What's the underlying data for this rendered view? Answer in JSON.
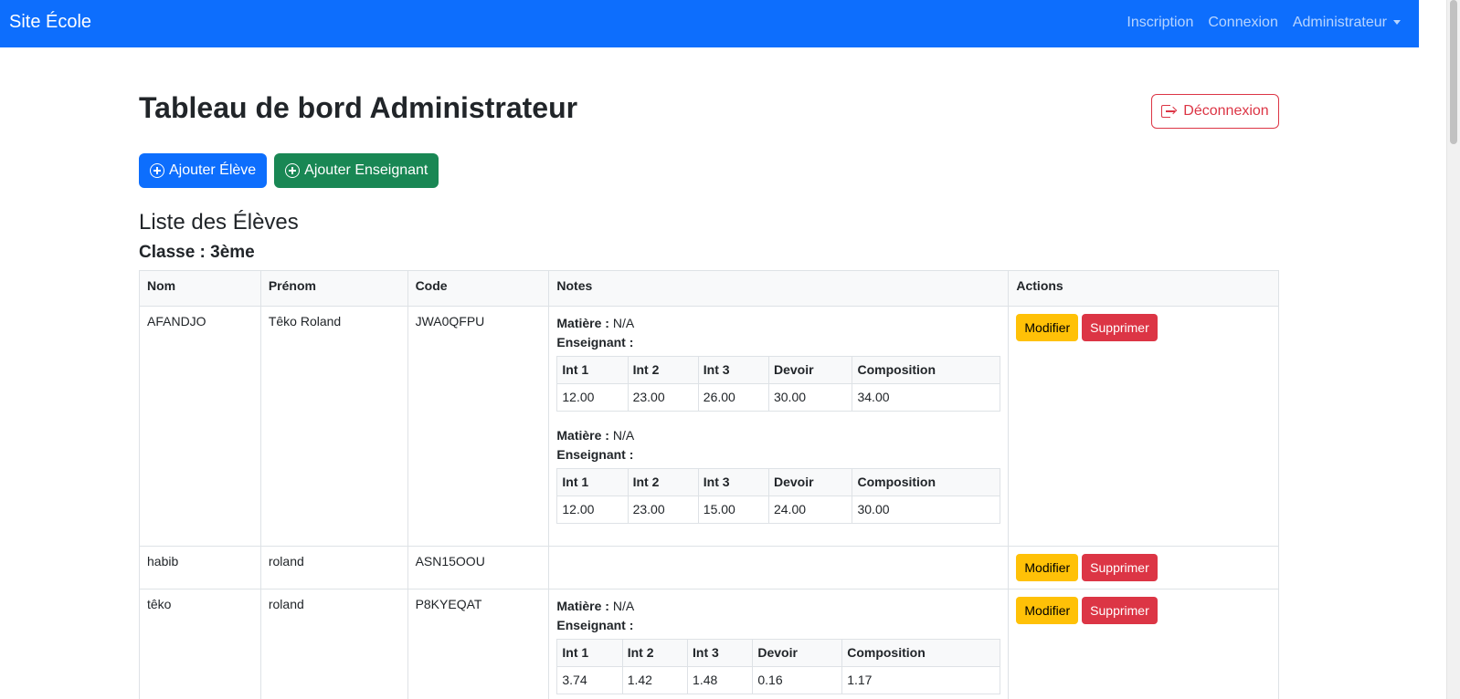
{
  "navbar": {
    "brand": "Site École",
    "links": [
      "Inscription",
      "Connexion"
    ],
    "admin_label": "Administrateur"
  },
  "header": {
    "title": "Tableau de bord Administrateur",
    "logout_label": "Déconnexion"
  },
  "toolbar": {
    "add_student_label": "Ajouter Élève",
    "add_teacher_label": "Ajouter Enseignant"
  },
  "list": {
    "title": "Liste des Élèves",
    "class_label": "Classe : 3ème",
    "columns": [
      "Nom",
      "Prénom",
      "Code",
      "Notes",
      "Actions"
    ],
    "grade_columns": [
      "Int 1",
      "Int 2",
      "Int 3",
      "Devoir",
      "Composition"
    ],
    "subject_label": "Matière :",
    "teacher_label": "Enseignant :",
    "edit_label": "Modifier",
    "delete_label": "Supprimer",
    "students": [
      {
        "nom": "AFANDJO",
        "prenom": "Têko Roland",
        "code": "JWA0QFPU",
        "notes": [
          {
            "subject": "N/A",
            "teacher": "",
            "grades": [
              "12.00",
              "23.00",
              "26.00",
              "30.00",
              "34.00"
            ]
          },
          {
            "subject": "N/A",
            "teacher": "",
            "grades": [
              "12.00",
              "23.00",
              "15.00",
              "24.00",
              "30.00"
            ]
          }
        ]
      },
      {
        "nom": "habib",
        "prenom": "roland",
        "code": "ASN15OOU",
        "notes": []
      },
      {
        "nom": "têko",
        "prenom": "roland",
        "code": "P8KYEQAT",
        "notes": [
          {
            "subject": "N/A",
            "teacher": "",
            "grades": [
              "3.74",
              "1.42",
              "1.48",
              "0.16",
              "1.17"
            ]
          }
        ]
      }
    ]
  },
  "colors": {
    "primary": "#0d6efd",
    "success": "#198754",
    "warning": "#ffc107",
    "danger": "#dc3545"
  }
}
